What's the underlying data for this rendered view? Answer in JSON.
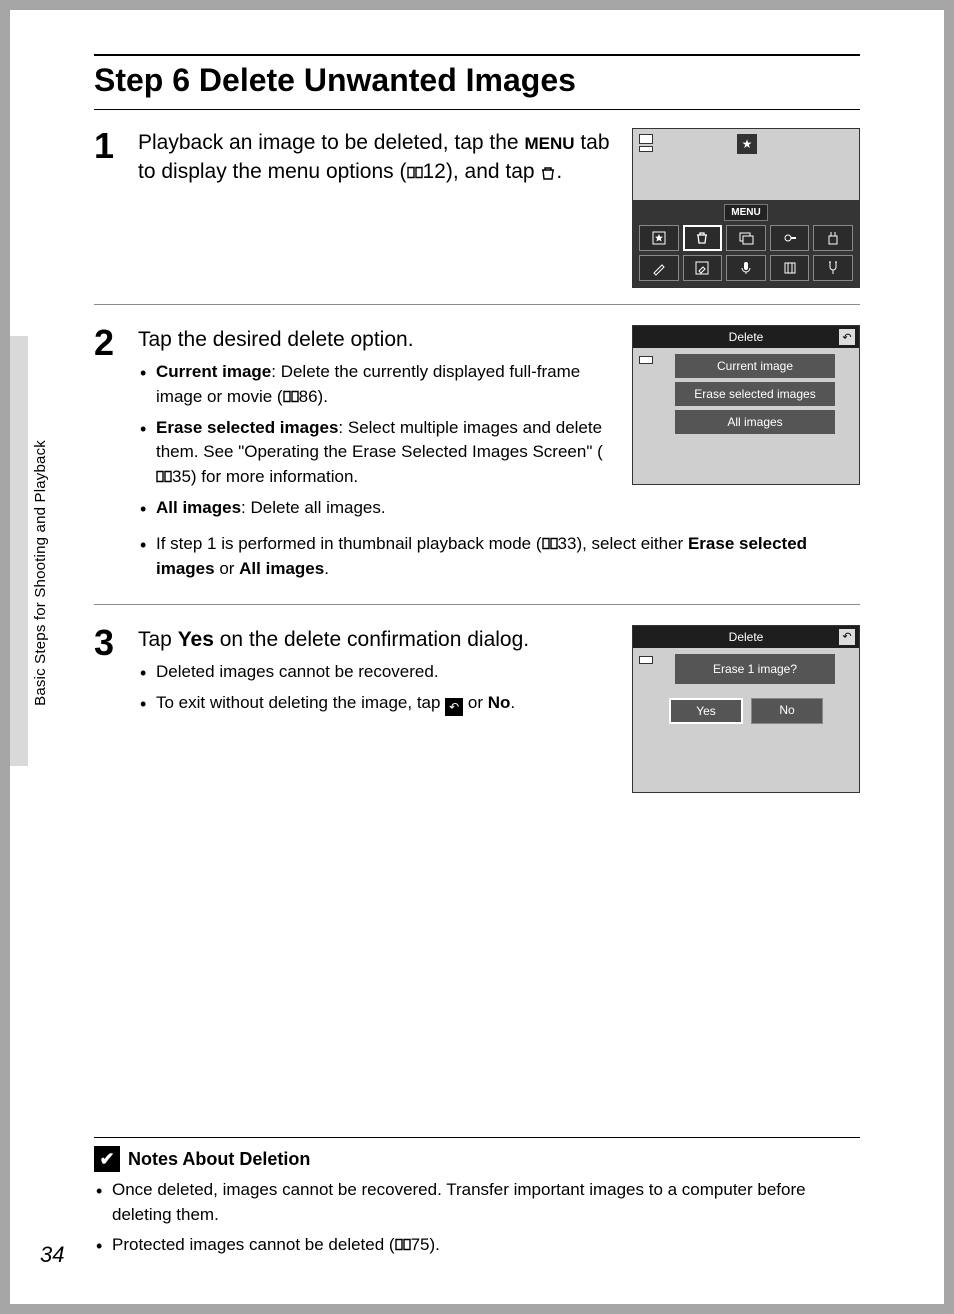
{
  "page": {
    "title": "Step 6 Delete Unwanted Images",
    "side_tab_label": "Basic Steps for Shooting and Playback",
    "page_number": "34"
  },
  "step1": {
    "text_pre": "Playback an image to be deleted, tap the ",
    "menu_word": "MENU",
    "text_mid1": " tab to display the menu options (",
    "ref12": "12",
    "text_mid2": "), and tap ",
    "text_end": ".",
    "screen": {
      "menu_band_label": "MENU",
      "star_glyph": "★",
      "icons": [
        "⭐",
        "🗑",
        "🖼",
        "🔑",
        "🔒",
        "✎",
        "✏",
        "🎤",
        "⛶",
        "🍴"
      ]
    }
  },
  "step2": {
    "main": "Tap the desired delete option.",
    "b1_label": "Current image",
    "b1_text_a": ": Delete the currently displayed full-frame image or movie (",
    "b1_ref": "86",
    "b1_text_b": ").",
    "b2_label": "Erase selected images",
    "b2_text_a": ": Select multiple images and delete them. See \"Operating the Erase Selected Images Screen\" (",
    "b2_ref": "35",
    "b2_text_b": ") for more information.",
    "b3_label": "All images",
    "b3_text": ": Delete all images.",
    "b4_text_a": "If step 1 is performed in thumbnail playback mode (",
    "b4_ref": "33",
    "b4_text_b": "), select either ",
    "b4_bold1": "Erase selected images",
    "b4_text_c": " or ",
    "b4_bold2": "All images",
    "b4_text_d": ".",
    "screen": {
      "title": "Delete",
      "items": [
        "Current image",
        "Erase selected images",
        "All images"
      ]
    }
  },
  "step3": {
    "main_a": "Tap ",
    "main_bold": "Yes",
    "main_b": " on the delete confirmation dialog.",
    "b1": "Deleted images cannot be recovered.",
    "b2_a": "To exit without deleting the image, tap ",
    "b2_b": " or ",
    "b2_bold": "No",
    "b2_c": ".",
    "screen": {
      "title": "Delete",
      "prompt": "Erase 1 image?",
      "yes": "Yes",
      "no": "No"
    }
  },
  "notes": {
    "heading": "Notes About Deletion",
    "n1": "Once deleted, images cannot be recovered. Transfer important images to a computer before deleting them.",
    "n2_a": "Protected images cannot be deleted (",
    "n2_ref": "75",
    "n2_b": ")."
  }
}
